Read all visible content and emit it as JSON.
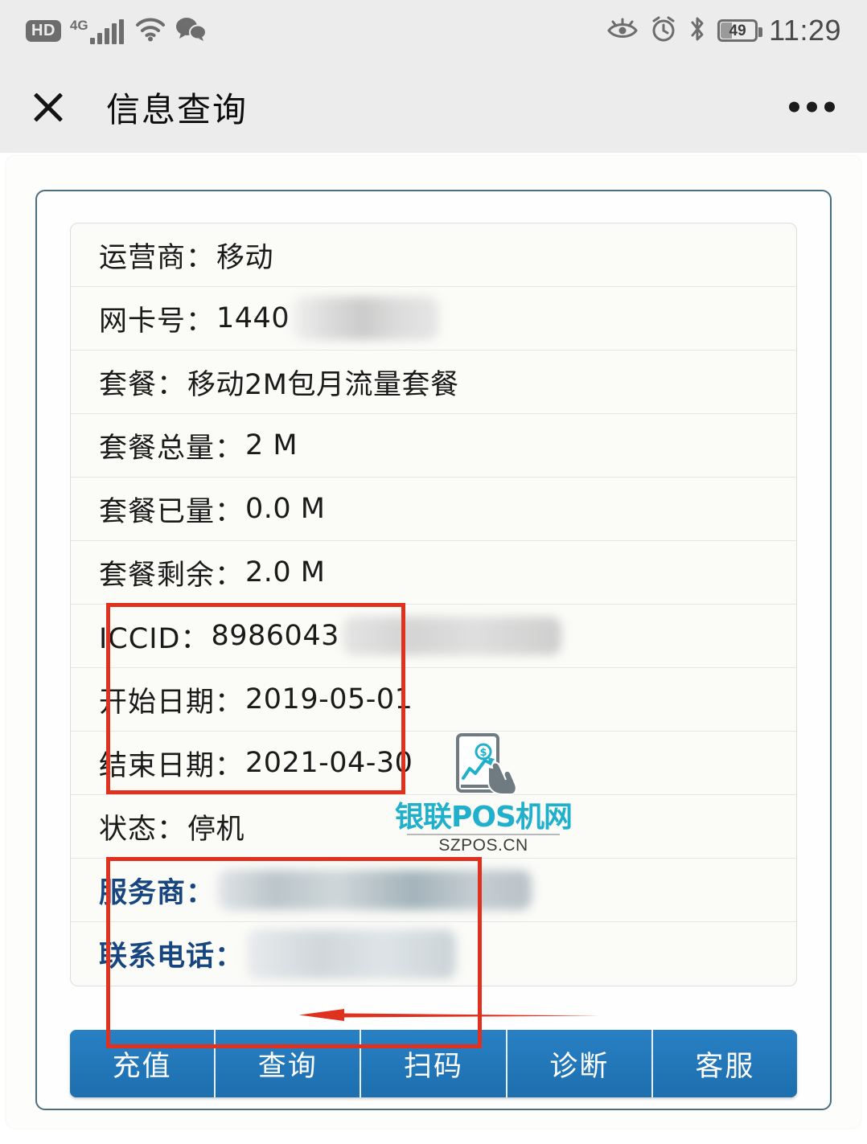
{
  "status_bar": {
    "hd_label": "HD",
    "network_label": "4G",
    "signal_icon": "signal-bars-icon",
    "wifi_icon": "wifi-icon",
    "wechat_icon": "wechat-icon",
    "eye_care_icon": "eye-care-icon",
    "alarm_icon": "alarm-clock-icon",
    "bluetooth_icon": "bluetooth-icon",
    "battery_level": "49",
    "time": "11:29"
  },
  "header": {
    "close_icon": "close-icon",
    "title": "信息查询",
    "more_icon": "more-options-icon"
  },
  "info_rows": [
    {
      "label": "运营商：",
      "value": "移动",
      "blurred": false,
      "link": false
    },
    {
      "label": "网卡号：",
      "value": "1440",
      "blurred": true,
      "link": false
    },
    {
      "label": "套餐：",
      "value": "移动2M包月流量套餐",
      "blurred": false,
      "link": false
    },
    {
      "label": "套餐总量：",
      "value": "2 M",
      "blurred": false,
      "link": false
    },
    {
      "label": "套餐已量：",
      "value": "0.0 M",
      "blurred": false,
      "link": false
    },
    {
      "label": "套餐剩余：",
      "value": "2.0 M",
      "blurred": false,
      "link": false
    },
    {
      "label": "ICCID：",
      "value": "8986043",
      "blurred": true,
      "link": false
    },
    {
      "label": "开始日期：",
      "value": "2019-05-01",
      "blurred": false,
      "link": false
    },
    {
      "label": "结束日期：",
      "value": "2021-04-30",
      "blurred": false,
      "link": false
    },
    {
      "label": "状态：",
      "value": "停机",
      "blurred": false,
      "link": false
    },
    {
      "label": "服务商：",
      "value": "",
      "blurred": true,
      "link": true
    },
    {
      "label": "联系电话：",
      "value": "",
      "blurred": true,
      "link": true
    }
  ],
  "buttons": [
    {
      "label": "充值"
    },
    {
      "label": "查询"
    },
    {
      "label": "扫码"
    },
    {
      "label": "诊断"
    },
    {
      "label": "客服"
    }
  ],
  "annotations": {
    "usage_box_name": "highlight-box-package-usage",
    "dates_box_name": "highlight-box-dates-status",
    "arrow_name": "red-arrow-pointing-to-status",
    "color": "#e0301e"
  },
  "watermark": {
    "title": "银联POS机网",
    "subtitle": "SZPOS.CN",
    "color": "#21b0cc",
    "logo_icon": "pos-terminal-hand-icon"
  }
}
